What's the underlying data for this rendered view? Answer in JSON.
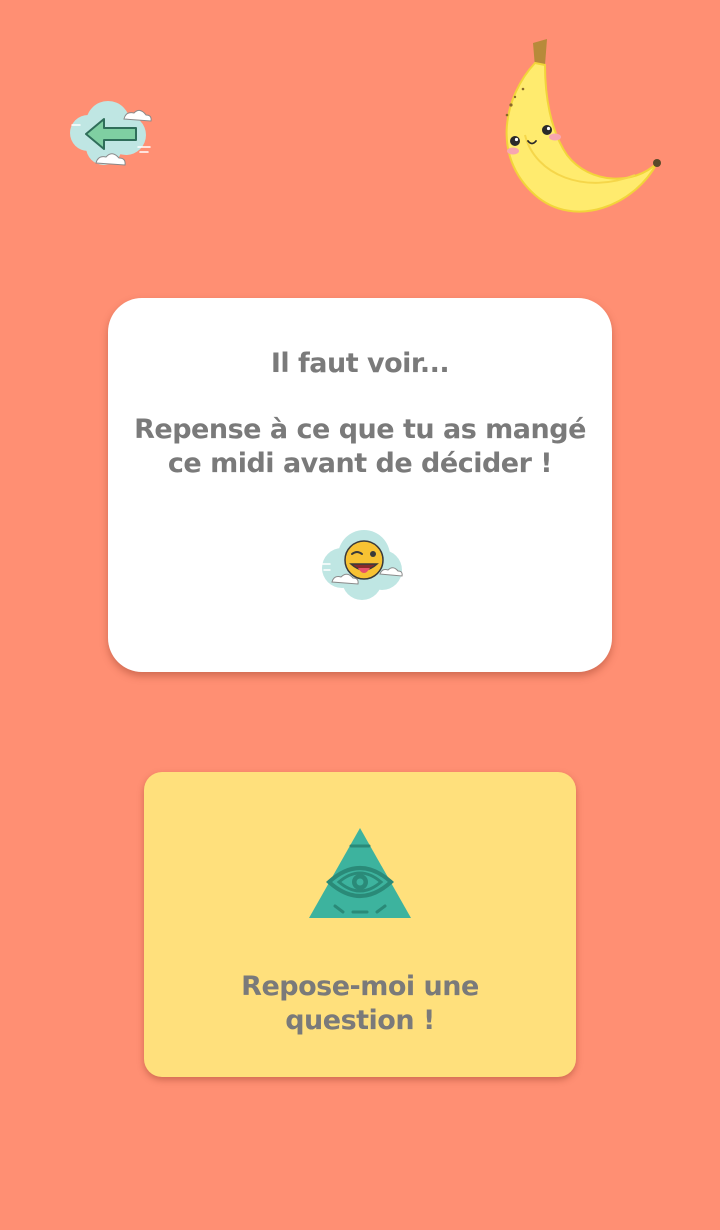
{
  "colors": {
    "background": "#FF8F73",
    "card": "#FFFFFF",
    "button": "#FFE07C",
    "text": "#7A7A7A",
    "accent_teal": "#3DB39E"
  },
  "header": {
    "back_icon": "back-arrow-cloud-icon",
    "mascot_icon": "banana-mascot-icon"
  },
  "answer": {
    "title": "Il faut voir...",
    "line1": "Repense à ce que tu as mangé",
    "line2": "ce midi avant de décider !",
    "emoji_icon": "wink-tongue-emoji-icon"
  },
  "ask_again": {
    "icon": "eye-pyramid-icon",
    "line1": "Repose-moi une",
    "line2": "question !"
  }
}
